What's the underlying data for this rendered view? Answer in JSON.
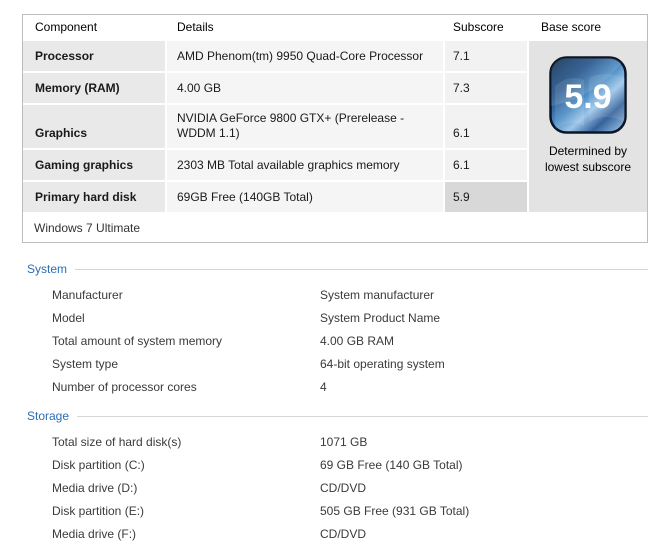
{
  "table": {
    "headers": {
      "component": "Component",
      "details": "Details",
      "subscore": "Subscore",
      "base_score": "Base score"
    },
    "rows": [
      {
        "component": "Processor",
        "details": "AMD Phenom(tm) 9950 Quad-Core Processor",
        "subscore": "7.1"
      },
      {
        "component": "Memory (RAM)",
        "details": "4.00 GB",
        "subscore": "7.3"
      },
      {
        "component": "Graphics",
        "details": "NVIDIA GeForce 9800 GTX+ (Prerelease - WDDM 1.1)",
        "subscore": "6.1"
      },
      {
        "component": "Gaming graphics",
        "details": "2303 MB Total available graphics memory",
        "subscore": "6.1"
      },
      {
        "component": "Primary hard disk",
        "details": "69GB Free (140GB Total)",
        "subscore": "5.9"
      }
    ],
    "footer": "Windows 7 Ultimate",
    "base_score": {
      "value": "5.9",
      "caption": "Determined by lowest subscore"
    }
  },
  "sections": [
    {
      "title": "System",
      "rows": [
        {
          "label": "Manufacturer",
          "value": "System manufacturer"
        },
        {
          "label": "Model",
          "value": "System Product Name"
        },
        {
          "label": "Total amount of system memory",
          "value": "4.00 GB RAM"
        },
        {
          "label": "System type",
          "value": "64-bit operating system"
        },
        {
          "label": "Number of processor cores",
          "value": "4"
        }
      ]
    },
    {
      "title": "Storage",
      "rows": [
        {
          "label": "Total size of hard disk(s)",
          "value": "1071 GB"
        },
        {
          "label": "Disk partition (C:)",
          "value": "69 GB Free (140 GB Total)"
        },
        {
          "label": "Media drive (D:)",
          "value": "CD/DVD"
        },
        {
          "label": "Disk partition (E:)",
          "value": "505 GB Free (931 GB Total)"
        },
        {
          "label": "Media drive (F:)",
          "value": "CD/DVD"
        }
      ]
    }
  ],
  "colors": {
    "section_title_blue": "#2b6eb5",
    "component_cell": "#e9e9e9",
    "details_cell": "#f5f5f5",
    "subscore_cell": "#f2f2f2",
    "lowest_subscore_cell": "#d8d8d8",
    "base_score_column": "#e3e3e3",
    "table_border": "#bcbcbc",
    "badge_blue_dark": "#0b2a4d",
    "badge_blue_light": "#9dc6ea"
  }
}
